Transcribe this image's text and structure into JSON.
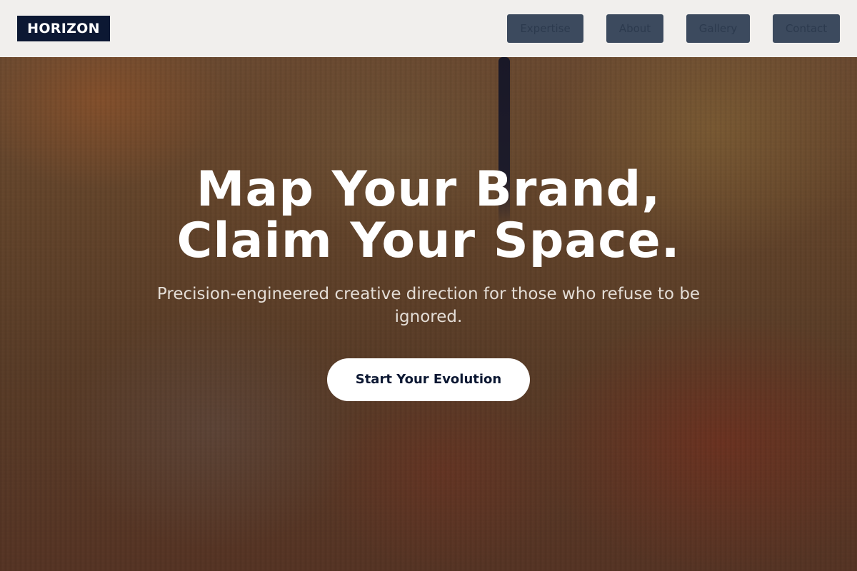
{
  "header": {
    "logo_text": "HORIZON",
    "nav": [
      {
        "label": "Expertise"
      },
      {
        "label": "About"
      },
      {
        "label": "Gallery"
      },
      {
        "label": "Contact"
      }
    ]
  },
  "hero": {
    "headline_line1": "Map Your Brand,",
    "headline_line2": "Claim Your Space.",
    "subheadline": "Precision-engineered creative direction for those who refuse to be ignored.",
    "cta_label": "Start Your Evolution"
  },
  "colors": {
    "header_background": "#f1efed",
    "logo_background": "#0c1833",
    "nav_button_background": "#3c4a5e",
    "cta_background": "#ffffff",
    "cta_text": "#0c1833"
  }
}
